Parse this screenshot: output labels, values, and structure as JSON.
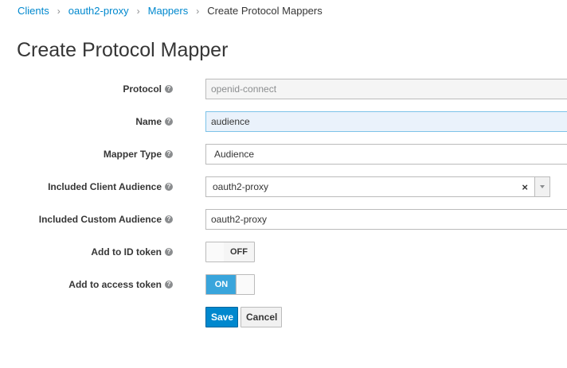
{
  "breadcrumb": {
    "items": [
      "Clients",
      "oauth2-proxy",
      "Mappers"
    ],
    "current": "Create Protocol Mappers"
  },
  "page_title": "Create Protocol Mapper",
  "form": {
    "protocol": {
      "label": "Protocol",
      "value": "openid-connect"
    },
    "name": {
      "label": "Name",
      "value": "audience"
    },
    "mapper_type": {
      "label": "Mapper Type",
      "value": "Audience"
    },
    "included_client_audience": {
      "label": "Included Client Audience",
      "value": "oauth2-proxy",
      "clear": "×"
    },
    "included_custom_audience": {
      "label": "Included Custom Audience",
      "value": "oauth2-proxy"
    },
    "add_to_id_token": {
      "label": "Add to ID token",
      "state": "OFF"
    },
    "add_to_access_token": {
      "label": "Add to access token",
      "state": "ON"
    }
  },
  "buttons": {
    "save": "Save",
    "cancel": "Cancel"
  },
  "icons": {
    "help": "question-circle-icon",
    "dropdown": "caret-down-icon"
  },
  "colors": {
    "link": "#0088ce",
    "primary": "#0088ce",
    "toggle_on": "#39a5dc"
  }
}
